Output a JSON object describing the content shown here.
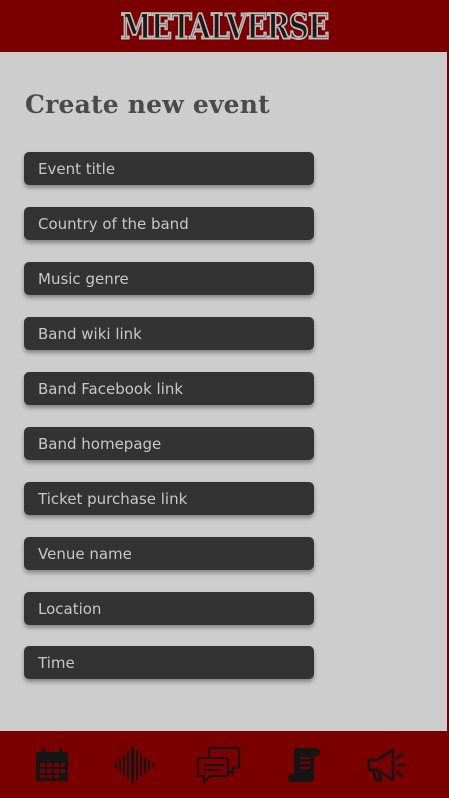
{
  "app": {
    "logo_text": "METALVERSE"
  },
  "page": {
    "title": "Create new event"
  },
  "form": {
    "fields": [
      {
        "placeholder": "Event title",
        "value": ""
      },
      {
        "placeholder": "Country of the band",
        "value": ""
      },
      {
        "placeholder": "Music genre",
        "value": ""
      },
      {
        "placeholder": "Band wiki link",
        "value": ""
      },
      {
        "placeholder": "Band Facebook link",
        "value": ""
      },
      {
        "placeholder": "Band homepage",
        "value": ""
      },
      {
        "placeholder": "Ticket purchase link",
        "value": ""
      },
      {
        "placeholder": "Venue name",
        "value": ""
      },
      {
        "placeholder": "Location",
        "value": ""
      },
      {
        "placeholder": "Time",
        "value": ""
      }
    ]
  },
  "nav": {
    "items": [
      {
        "icon": "calendar-icon"
      },
      {
        "icon": "audio-waveform-icon"
      },
      {
        "icon": "chat-bubbles-icon"
      },
      {
        "icon": "scroll-document-icon"
      },
      {
        "icon": "megaphone-icon"
      }
    ]
  },
  "colors": {
    "brand_red": "#7a0000",
    "background": "#cdcdcd",
    "field": "#333333",
    "icon": "#151515"
  }
}
